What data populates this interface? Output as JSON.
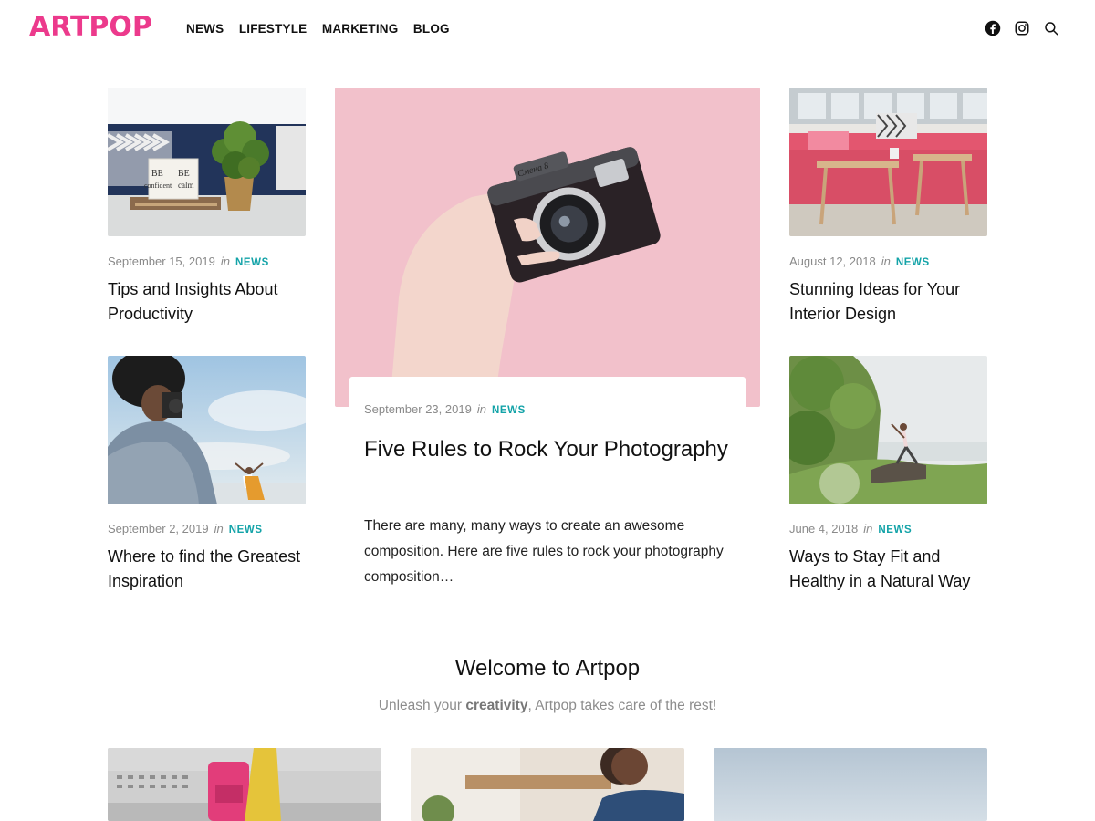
{
  "brand": {
    "logo": "ARTPOP",
    "accent": "#ec3a8c",
    "category_color": "#13a3a8"
  },
  "nav": [
    "NEWS",
    "LIFESTYLE",
    "MARKETING",
    "BLOG"
  ],
  "social": [
    "facebook-icon",
    "instagram-icon",
    "search-icon"
  ],
  "in_word": "in",
  "posts": {
    "tl": {
      "date": "September 15, 2019",
      "category": "NEWS",
      "title": "Tips and Insights About Productivity",
      "image": "desk with BE confident BE calm mug and plant"
    },
    "bl": {
      "date": "September 2, 2019",
      "category": "NEWS",
      "title": "Where to find the Greatest Inspiration",
      "image": "photographer shooting woman under sky"
    },
    "tr": {
      "date": "August 12, 2018",
      "category": "NEWS",
      "title": "Stunning Ideas for Your Interior Design",
      "image": "pink sofa and wooden table"
    },
    "br": {
      "date": "June 4, 2018",
      "category": "NEWS",
      "title": "Ways to Stay Fit and Healthy in a Natural Way",
      "image": "yoga pose by the sea"
    }
  },
  "featured": {
    "date": "September 23, 2019",
    "category": "NEWS",
    "title": "Five Rules to Rock Your Photography",
    "excerpt": "There are many, many ways to create an awesome composition. Here are five rules to rock your photography composition…",
    "image_camera_label": "Смена 8"
  },
  "welcome": {
    "title": "Welcome to Artpop",
    "sub_before": "Unleash your ",
    "sub_bold": "creativity",
    "sub_after": ", Artpop takes care of the rest!"
  },
  "tl_mug": {
    "left": "BE\nconfident",
    "right": "BE\ncalm"
  }
}
